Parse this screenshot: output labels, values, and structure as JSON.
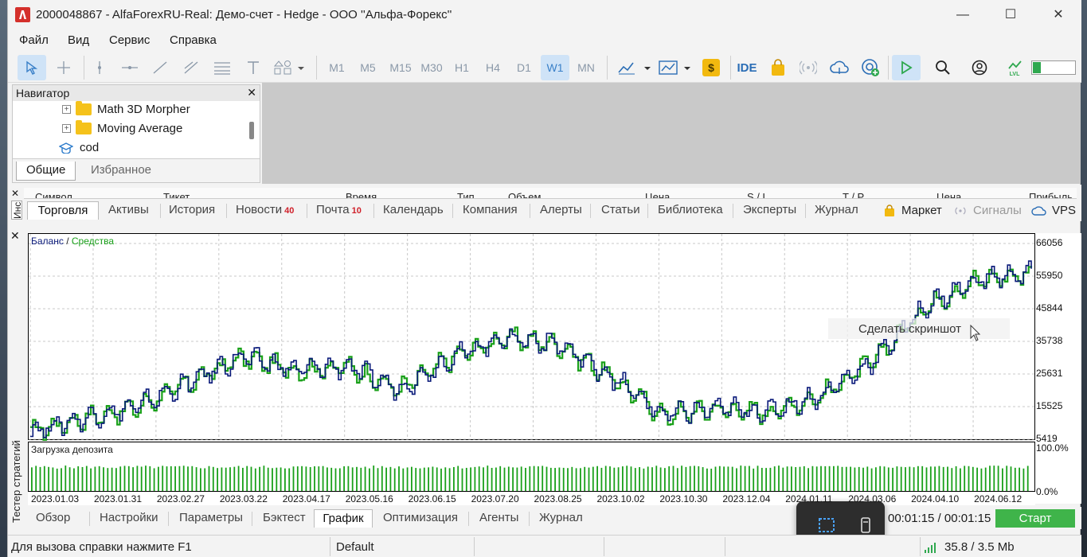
{
  "window": {
    "title": "2000048867 - AlfaForexRU-Real: Демо-счет - Hedge - ООО ''Альфа-Форекс''",
    "minimize": "—",
    "maximize": "☐",
    "close": "✕"
  },
  "menu": [
    "Файл",
    "Вид",
    "Сервис",
    "Справка"
  ],
  "toolbar": {
    "timeframes": [
      "M1",
      "M5",
      "M15",
      "M30",
      "H1",
      "H4",
      "D1",
      "W1",
      "MN"
    ],
    "selected_timeframe": "W1",
    "ide_label": "IDE"
  },
  "navigator": {
    "title": "Навигатор",
    "items": [
      {
        "label": "Math 3D Morpher",
        "type": "folder"
      },
      {
        "label": "Moving Average",
        "type": "folder"
      },
      {
        "label": "cod",
        "type": "course"
      }
    ],
    "tabs": [
      "Общие",
      "Избранное"
    ],
    "active_tab": "Общие"
  },
  "toolbox": {
    "side_label": "Инс",
    "columns": [
      "Символ",
      "Тикет",
      "Время",
      "Тип",
      "Объем",
      "Цена",
      "S / L",
      "T / P",
      "Цена",
      "Прибыль"
    ],
    "tabs": [
      {
        "label": "Торговля",
        "badge": ""
      },
      {
        "label": "Активы",
        "badge": ""
      },
      {
        "label": "История",
        "badge": ""
      },
      {
        "label": "Новости",
        "badge": "40"
      },
      {
        "label": "Почта",
        "badge": "10"
      },
      {
        "label": "Календарь",
        "badge": ""
      },
      {
        "label": "Компания",
        "badge": ""
      },
      {
        "label": "Алерты",
        "badge": ""
      },
      {
        "label": "Статьи",
        "badge": ""
      },
      {
        "label": "Библиотека",
        "badge": ""
      },
      {
        "label": "Эксперты",
        "badge": ""
      },
      {
        "label": "Журнал",
        "badge": ""
      }
    ],
    "active_tab": "Торговля",
    "market": "Маркет",
    "signals": "Сигналы",
    "vps": "VPS"
  },
  "tester": {
    "side_label": "Тестер стратегий",
    "legend_balance": "Баланс",
    "legend_sep": " / ",
    "legend_equity": "Средства",
    "load_title": "Загрузка депозита",
    "load_ticks": [
      "100.0%",
      "0.0%"
    ],
    "context_menu": "Сделать скриншот",
    "tabs": [
      "Обзор",
      "Настройки",
      "Параметры",
      "Бэктест",
      "График",
      "Оптимизация",
      "Агенты",
      "Журнал"
    ],
    "active_tab": "График",
    "timer": "00:01:15 / 00:01:15",
    "start": "Старт"
  },
  "chart_data": {
    "type": "line",
    "x_labels": [
      "2023.01.03",
      "2023.01.31",
      "2023.02.27",
      "2023.03.22",
      "2023.04.17",
      "2023.05.16",
      "2023.06.15",
      "2023.07.20",
      "2023.08.25",
      "2023.10.02",
      "2023.10.30",
      "2023.12.04",
      "2024.01.11",
      "2024.03.06",
      "2024.04.10",
      "2024.06.12"
    ],
    "y_ticks": [
      66056,
      55950,
      45844,
      35738,
      25631,
      15525,
      5419
    ],
    "ylim": [
      5419,
      66056
    ],
    "series": [
      {
        "name": "Баланс",
        "color": "#0a1a7a",
        "values": [
          8000,
          12000,
          15500,
          23000,
          31000,
          27000,
          28000,
          21000,
          31000,
          37000,
          35000,
          25000,
          13000,
          15000,
          14000,
          19000,
          30000,
          47000,
          55000,
          57000
        ]
      },
      {
        "name": "Средства",
        "color": "#19a019",
        "values": [
          7800,
          11800,
          15200,
          22800,
          30800,
          26800,
          27800,
          20800,
          30800,
          36800,
          34800,
          24800,
          12800,
          14800,
          13800,
          18800,
          29800,
          46800,
          54800,
          56800
        ]
      }
    ],
    "load_bar_color": "#19a019",
    "grid": true
  },
  "status": {
    "help": "Для вызова справки нажмите F1",
    "profile": "Default",
    "traffic": "35.8 / 3.5 Mb"
  }
}
